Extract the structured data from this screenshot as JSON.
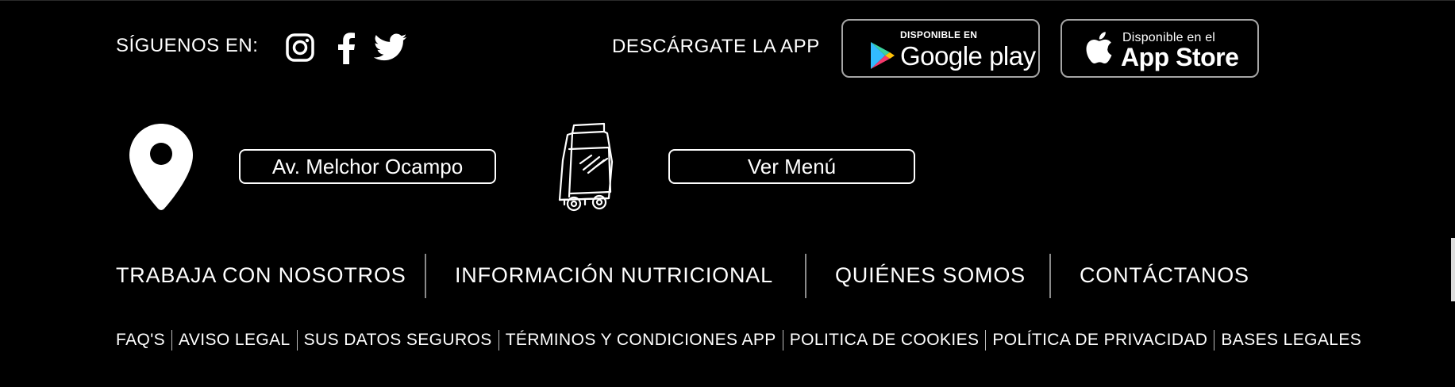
{
  "social": {
    "label": "SÍGUENOS EN:",
    "icons": [
      "instagram-icon",
      "facebook-icon",
      "twitter-icon"
    ]
  },
  "app": {
    "label": "DESCÁRGATE LA APP",
    "google": {
      "small": "DISPONIBLE EN",
      "big": "Google play"
    },
    "apple": {
      "small": "Disponible en el",
      "big": "App Store"
    }
  },
  "location": {
    "address": "Av. Melchor Ocampo",
    "menu": "Ver Menú"
  },
  "nav": {
    "items": [
      "TRABAJA CON NOSOTROS",
      "INFORMACIÓN NUTRICIONAL",
      "QUIÉNES SOMOS",
      "CONTÁCTANOS"
    ]
  },
  "legal": {
    "items": [
      "FAQ'S",
      "AVISO LEGAL",
      "SUS DATOS SEGUROS",
      "TÉRMINOS Y CONDICIONES APP",
      "POLITICA DE COOKIES",
      "POLÍTICA DE PRIVACIDAD",
      "BASES LEGALES"
    ]
  },
  "colors": {
    "background": "#000000",
    "text": "#ffffff",
    "badge_border": "#a6a6a6"
  }
}
